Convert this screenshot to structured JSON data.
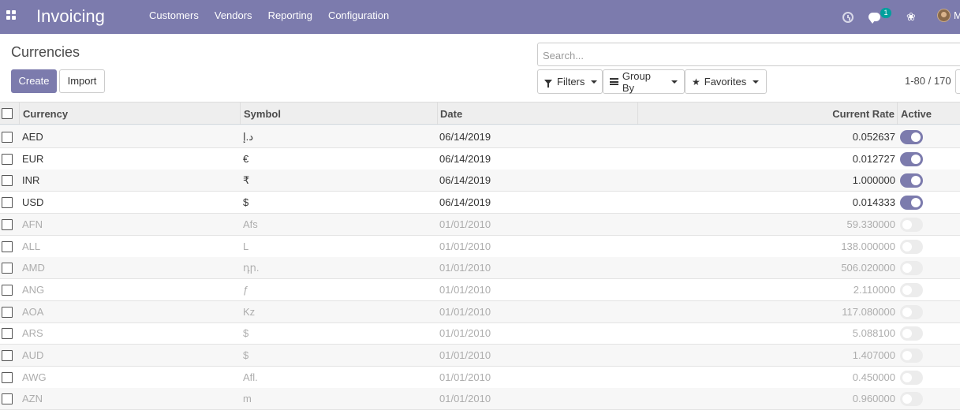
{
  "navbar": {
    "app_title": "Invoicing",
    "menu": [
      "Customers",
      "Vendors",
      "Reporting",
      "Configuration"
    ],
    "chat_badge": "1",
    "user_initial": "M",
    "icons": [
      "apps-grid-icon",
      "clock-icon",
      "chat-icon",
      "bug-icon",
      "avatar"
    ]
  },
  "control": {
    "breadcrumb": "Currencies",
    "create_label": "Create",
    "import_label": "Import",
    "search_placeholder": "Search...",
    "filters_label": "Filters",
    "groupby_label": "Group By",
    "favorites_label": "Favorites",
    "pager": "1-80 / 170"
  },
  "table": {
    "headers": {
      "currency": "Currency",
      "symbol": "Symbol",
      "date": "Date",
      "rate": "Current Rate",
      "active": "Active"
    },
    "rows": [
      {
        "currency": "AED",
        "symbol": "د.إ",
        "date": "06/14/2019",
        "rate": "0.052637",
        "active": true
      },
      {
        "currency": "EUR",
        "symbol": "€",
        "date": "06/14/2019",
        "rate": "0.012727",
        "active": true
      },
      {
        "currency": "INR",
        "symbol": "₹",
        "date": "06/14/2019",
        "rate": "1.000000",
        "active": true
      },
      {
        "currency": "USD",
        "symbol": "$",
        "date": "06/14/2019",
        "rate": "0.014333",
        "active": true
      },
      {
        "currency": "AFN",
        "symbol": "Afs",
        "date": "01/01/2010",
        "rate": "59.330000",
        "active": false
      },
      {
        "currency": "ALL",
        "symbol": "L",
        "date": "01/01/2010",
        "rate": "138.000000",
        "active": false
      },
      {
        "currency": "AMD",
        "symbol": "դր.",
        "date": "01/01/2010",
        "rate": "506.020000",
        "active": false
      },
      {
        "currency": "ANG",
        "symbol": "ƒ",
        "date": "01/01/2010",
        "rate": "2.110000",
        "active": false
      },
      {
        "currency": "AOA",
        "symbol": "Kz",
        "date": "01/01/2010",
        "rate": "117.080000",
        "active": false
      },
      {
        "currency": "ARS",
        "symbol": "$",
        "date": "01/01/2010",
        "rate": "5.088100",
        "active": false
      },
      {
        "currency": "AUD",
        "symbol": "$",
        "date": "01/01/2010",
        "rate": "1.407000",
        "active": false
      },
      {
        "currency": "AWG",
        "symbol": "Afl.",
        "date": "01/01/2010",
        "rate": "0.450000",
        "active": false
      },
      {
        "currency": "AZN",
        "symbol": "m",
        "date": "01/01/2010",
        "rate": "0.960000",
        "active": false
      }
    ]
  },
  "colors": {
    "brand": "#7c7bad",
    "badge": "#00a09d",
    "toggle_off": "#ececec",
    "inactive_text": "#adadad"
  }
}
